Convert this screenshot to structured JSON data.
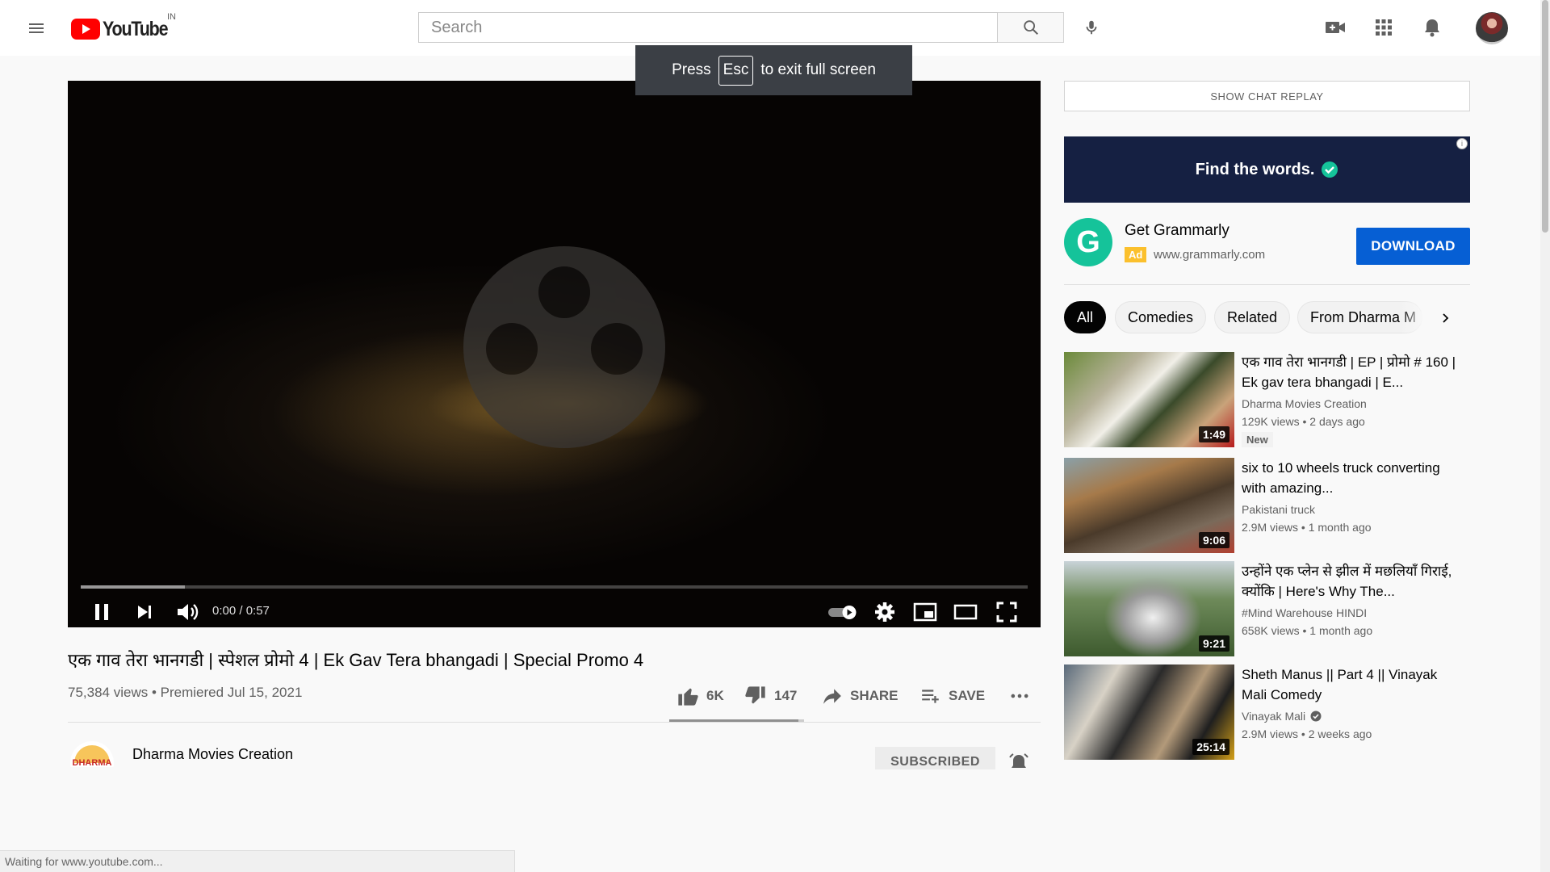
{
  "header": {
    "logo_text": "YouTube",
    "country_code": "IN",
    "search_placeholder": "Search",
    "icons": [
      "menu-icon",
      "search-icon",
      "mic-icon",
      "create-video-icon",
      "apps-icon",
      "notifications-icon"
    ]
  },
  "fullscreen_toast": {
    "prefix": "Press",
    "key": "Esc",
    "suffix": "to exit full screen"
  },
  "player": {
    "time": "0:00 / 0:57",
    "progress_fraction": 0.11,
    "autoplay_on": true
  },
  "video": {
    "title": "एक गाव तेरा भानगडी | स्पेशल प्रोमो 4 | Ek Gav Tera bhangadi | Special Promo 4",
    "views_date": "75,384 views • Premiered Jul 15, 2021",
    "likes": "6K",
    "dislikes": "147",
    "share_label": "SHARE",
    "save_label": "SAVE"
  },
  "channel": {
    "name": "Dharma Movies Creation",
    "logo_text": "DHARMA",
    "subscribe_label": "SUBSCRIBED"
  },
  "sidebar": {
    "chat_replay_label": "SHOW CHAT REPLAY",
    "ad": {
      "banner_text": "Find the words.",
      "info_glyph": "i",
      "title": "Get Grammarly",
      "badge": "Ad",
      "url": "www.grammarly.com",
      "logo_letter": "G",
      "button_label": "DOWNLOAD",
      "banner_color": "#152042"
    },
    "chips": [
      "All",
      "Comedies",
      "Related",
      "From Dharma M"
    ],
    "recommendations": [
      {
        "title": "एक गाव तेरा भानगडी | EP | प्रोमो # 160 | Ek gav tera bhangadi | E...",
        "channel": "Dharma Movies Creation",
        "meta": "129K views • 2 days ago",
        "badge": "New",
        "duration": "1:49",
        "verified": false
      },
      {
        "title": "six to 10 wheels truck converting with amazing...",
        "channel": "Pakistani truck",
        "meta": "2.9M views • 1 month ago",
        "duration": "9:06",
        "verified": false
      },
      {
        "title": "उन्होंने एक प्लेन से झील में मछलियाँ गिराई, क्योंकि | Here's Why The...",
        "channel": "#Mind Warehouse HINDI",
        "meta": "658K views • 1 month ago",
        "duration": "9:21",
        "verified": false
      },
      {
        "title": "Sheth Manus || Part 4 || Vinayak Mali Comedy",
        "channel": "Vinayak Mali",
        "meta": "2.9M views • 2 weeks ago",
        "duration": "25:14",
        "verified": true
      }
    ]
  },
  "status_bar": {
    "text": "Waiting for www.youtube.com..."
  },
  "colors": {
    "brand_red": "#ff0000",
    "accent_blue": "#065fd4",
    "grammarly_green": "#15c39a"
  }
}
